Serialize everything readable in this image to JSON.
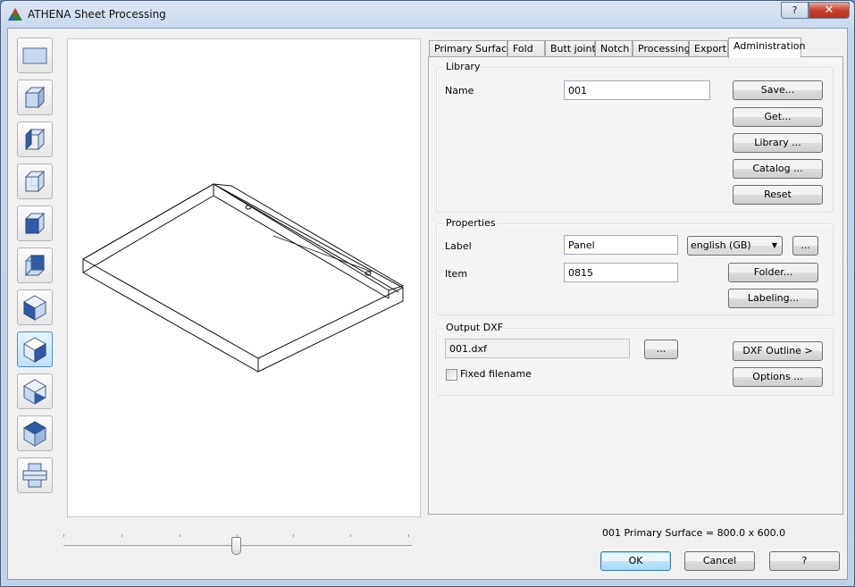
{
  "window": {
    "title": "ATHENA Sheet Processing",
    "help_button": "?",
    "close_button": "✕"
  },
  "view_toolbar": {
    "items": [
      {
        "icon": "front-plane-view-icon"
      },
      {
        "icon": "cube-iso-1-icon"
      },
      {
        "icon": "cube-iso-2-icon"
      },
      {
        "icon": "cube-iso-3-icon"
      },
      {
        "icon": "cube-iso-4-icon"
      },
      {
        "icon": "cube-iso-5-icon"
      },
      {
        "icon": "diamond-iso-1-icon"
      },
      {
        "icon": "diamond-iso-2-icon",
        "active": true
      },
      {
        "icon": "diamond-iso-3-icon"
      },
      {
        "icon": "diamond-iso-4-icon"
      },
      {
        "icon": "layered-view-icon"
      }
    ]
  },
  "tabs": [
    "Primary Surface",
    "Fold",
    "Butt joint",
    "Notch",
    "Processing",
    "Export",
    "Administration"
  ],
  "selected_tab": "Administration",
  "library": {
    "legend": "Library",
    "name_label": "Name",
    "name_value": "001",
    "save_button": "Save...",
    "get_button": "Get...",
    "library_button": "Library ...",
    "catalog_button": "Catalog ...",
    "reset_button": "Reset"
  },
  "properties": {
    "legend": "Properties",
    "label_label": "Label",
    "label_value": "Panel",
    "language_selected": "english (GB)",
    "language_more_button": "...",
    "item_label": "Item",
    "item_value": "0815",
    "folder_button": "Folder...",
    "labeling_button": "Labeling..."
  },
  "output": {
    "legend": "Output DXF",
    "filename_value": "001.dxf",
    "browse_button": "...",
    "dxf_outline_button": "DXF Outline >",
    "options_button": "Options ...",
    "fixed_filename_label": "Fixed filename",
    "fixed_filename_checked": false
  },
  "status": "001 Primary Surface = 800.0 x 600.0",
  "footer": {
    "ok_button": "OK",
    "cancel_button": "Cancel",
    "help_button": "?"
  }
}
